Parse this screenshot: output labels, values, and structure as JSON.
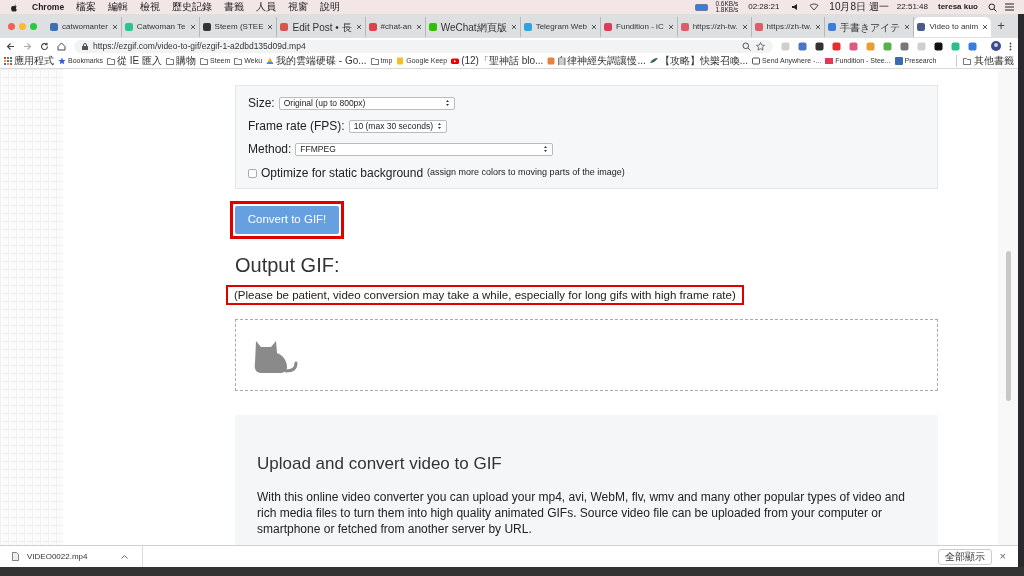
{
  "menubar": {
    "app": "Chrome",
    "menus": [
      "檔案",
      "編輯",
      "檢視",
      "歷史記錄",
      "書籤",
      "人員",
      "視窗",
      "說明"
    ],
    "net_speed": [
      "0.6KB/s",
      "1.8KB/s"
    ],
    "timer": "02:28:21",
    "date": "10月8日 週一",
    "time": "22:51:48",
    "user": "teresa kuo"
  },
  "tabs": [
    {
      "label": "catwomanter",
      "selected": false,
      "color": "#3b6fb6"
    },
    {
      "label": "Catwoman Te",
      "selected": false,
      "color": "#2bc48a"
    },
    {
      "label": "Steem (STEE",
      "selected": false,
      "color": "#333333"
    },
    {
      "label": "Edit Post • 長",
      "selected": false,
      "color": "#d9534f"
    },
    {
      "label": "#chat-an",
      "selected": false,
      "color": "#e0404a"
    },
    {
      "label": "WeChat網頁版",
      "selected": false,
      "color": "#2dc100"
    },
    {
      "label": "Telegram Web",
      "selected": false,
      "color": "#2aa3e0"
    },
    {
      "label": "Fundition - iC",
      "selected": false,
      "color": "#e03a5a"
    },
    {
      "label": "https://zh-tw.",
      "selected": false,
      "color": "#e05a6a"
    },
    {
      "label": "https://zh-tw.",
      "selected": false,
      "color": "#e05a6a"
    },
    {
      "label": "手書きアイテ",
      "selected": false,
      "color": "#3b7dd8"
    },
    {
      "label": "Video to anim",
      "selected": true,
      "color": "#4a5a8a"
    }
  ],
  "new_tab": "+",
  "address": {
    "url": "https://ezgif.com/video-to-gif/ezgif-1-a2dbd135d09d.mp4"
  },
  "bookmarks": [
    {
      "label": "應用程式",
      "kind": "apps"
    },
    {
      "label": "Bookmarks",
      "kind": "star"
    },
    {
      "label": "從 IE 匯入",
      "kind": "folder"
    },
    {
      "label": "購物",
      "kind": "folder"
    },
    {
      "label": "Steem",
      "kind": "folder"
    },
    {
      "label": "Weku",
      "kind": "folder"
    },
    {
      "label": "我的雲端硬碟 - Go...",
      "kind": "drive"
    },
    {
      "label": "tmp",
      "kind": "folder"
    },
    {
      "label": "Google Keep",
      "kind": "keep"
    },
    {
      "label": "(12)「聖神話 blo...",
      "kind": "video"
    },
    {
      "label": "自律神經失調讓慢...",
      "kind": "shield"
    },
    {
      "label": "【攻略】快樂召喚...",
      "kind": "leaf"
    },
    {
      "label": "Send Anywhere -...",
      "kind": "send"
    },
    {
      "label": "Fundition - Stee...",
      "kind": "flag"
    },
    {
      "label": "Presearch",
      "kind": "p"
    }
  ],
  "other_bookmarks": "其他書籤",
  "form": {
    "fields": [
      {
        "label": "Size:",
        "value": "Original (up to 800px)",
        "kind": "select-wide"
      },
      {
        "label": "Frame rate (FPS):",
        "value": "10 (max 30 seconds)",
        "kind": "select"
      },
      {
        "label": "Method:",
        "value": "FFMPEG",
        "kind": "select-long"
      }
    ],
    "option": {
      "label": "Optimize for static background",
      "hint": "(assign more colors to moving parts of the image)",
      "checked": false
    }
  },
  "convert_button": {
    "label": "Convert to GIF!",
    "highlighted": true
  },
  "output": {
    "heading": "Output GIF:",
    "note": "(Please be patient, video conversion may take a while, especially for long gifs with high frame rate)",
    "note_highlighted": true
  },
  "info": {
    "heading": "Upload and convert video to GIF",
    "text": "With this online video converter you can upload your mp4, avi, WebM, flv, wmv and many other popular types of video and rich media files to turn them into high quality animated GIFs. Source video file can be uploaded from your computer or smartphone or fetched from another server by URL."
  },
  "downloads": {
    "file": "VIDEO0022.mp4",
    "show_all": "全部顯示",
    "close": "×"
  }
}
